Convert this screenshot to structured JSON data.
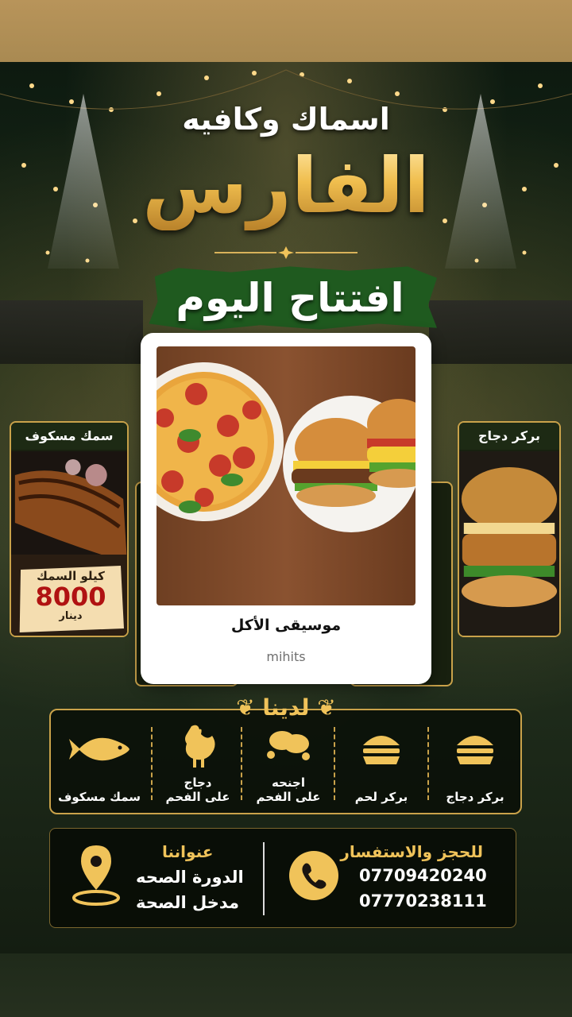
{
  "header": {
    "subtitle": "اسماك وكافيه",
    "name": "الفارس",
    "opening": "افتتاح اليوم"
  },
  "side_cards": {
    "left_label": "سمك مسكوف",
    "right_label": "بركر دجاج",
    "price": {
      "unit_label": "كيلو السمك",
      "amount": "8000",
      "currency": "دينار"
    }
  },
  "music_card": {
    "title": "موسيقى الأكل",
    "subtitle": "mihits"
  },
  "offers": {
    "title": "لدينا",
    "items": [
      {
        "label": "بركر دجاج",
        "icon": "burger-icon"
      },
      {
        "label": "بركر لحم",
        "icon": "burger-icon"
      },
      {
        "label": "اجنحه على الفحم",
        "line1": "اجنحه",
        "line2": "على الفحم",
        "icon": "chicken-wings-icon"
      },
      {
        "label": "دجاج على الفحم",
        "line1": "دجاج",
        "line2": "على الفحم",
        "icon": "rooster-icon"
      },
      {
        "label": "سمك مسكوف",
        "icon": "fish-icon"
      }
    ]
  },
  "contact": {
    "booking_title": "للحجز والاستفسار",
    "phone1": "07709420240",
    "phone2": "07770238111",
    "address_title": "عنواننا",
    "address_line1": "الدورة الصحه",
    "address_line2": "مدخل الصحة"
  },
  "colors": {
    "gold": "#f0c35a",
    "banner_green": "#1f5a1f",
    "dark": "#0d1a10",
    "price_red": "#b01212"
  }
}
